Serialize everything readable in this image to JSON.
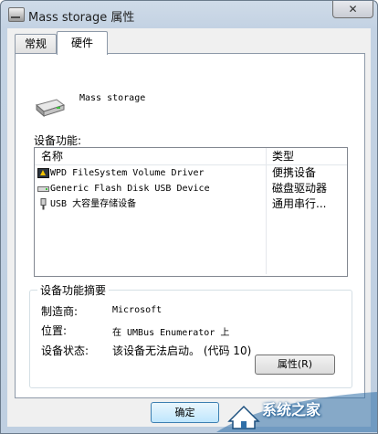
{
  "window": {
    "title": "Mass storage 属性",
    "close_label": "✕",
    "icon": "usb-device-icon"
  },
  "tabs": [
    {
      "label": "常规",
      "selected": false
    },
    {
      "label": "硬件",
      "selected": true
    }
  ],
  "device": {
    "name": "Mass storage",
    "icon": "drive-icon"
  },
  "functions": {
    "label": "设备功能:",
    "columns": {
      "name": "名称",
      "type": "类型"
    },
    "rows": [
      {
        "name": "WPD FileSystem Volume Driver",
        "type": "便携设备",
        "icon": "portable-device-icon"
      },
      {
        "name": "Generic Flash Disk USB Device",
        "type": "磁盘驱动器",
        "icon": "disk-drive-icon"
      },
      {
        "name": "USB 大容量存储设备",
        "type": "通用串行...",
        "icon": "usb-icon"
      }
    ]
  },
  "summary": {
    "title": "设备功能摘要",
    "manufacturer_label": "制造商:",
    "manufacturer_value": "Microsoft",
    "location_label": "位置:",
    "location_value": "在 UMBus Enumerator 上",
    "status_label": "设备状态:",
    "status_value": "该设备无法启动。 (代码 10)"
  },
  "buttons": {
    "properties": "属性(R)",
    "ok": "确定"
  },
  "watermark": {
    "text": "系统之家"
  },
  "colors": {
    "frame": "#bfcfe1",
    "ok_button": "#bee6fd",
    "watermark": "#2f6fa8"
  }
}
